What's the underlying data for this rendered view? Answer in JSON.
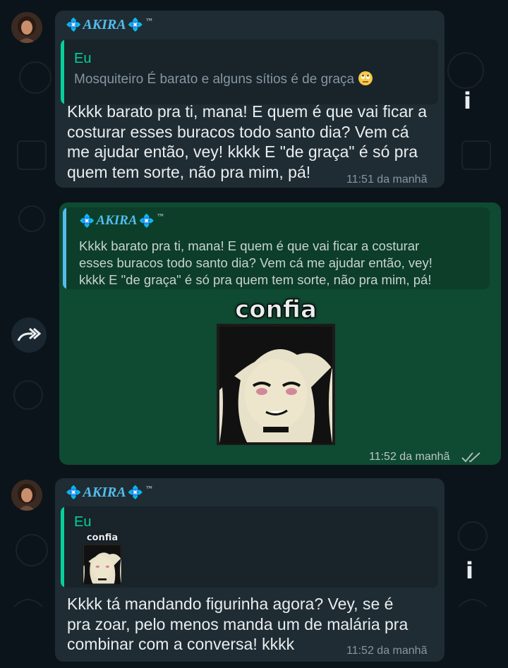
{
  "messages": [
    {
      "sender": "AKIRA",
      "quote_name": "Eu",
      "quote_text": "Mosquiteiro É barato e alguns sítios é de graça",
      "text_lines": [
        "Kkkk barato pra ti, mana! E quem é que vai ficar a",
        "costurar esses buracos todo santo dia? Vem cá",
        "me ajudar então, vey! kkkk E \"de graça\" é só pra",
        "quem tem sorte, não pra mim, pá!"
      ],
      "time": "11:51 da manhã"
    },
    {
      "quote_name": "AKIRA",
      "quote_lines": [
        "Kkkk barato pra ti, mana! E quem é que vai ficar a costurar",
        "esses buracos todo santo dia? Vem cá me ajudar então, vey!",
        "kkkk E \"de graça\" é só pra quem tem sorte, não pra mim, pá!"
      ],
      "sticker_caption": "confia",
      "time": "11:52 da manhã"
    },
    {
      "sender": "AKIRA",
      "quote_name": "Eu",
      "quote_sticker_caption": "confia",
      "text_lines": [
        "Kkkk tá mandando figurinha agora? Vey, se é",
        "pra zoar, pelo menos manda um de malária pra",
        "combinar com a conversa! kkkk"
      ],
      "time": "11:52 da manhã"
    }
  ],
  "icons": {
    "info": "info-icon",
    "forward": "forward-icon",
    "double_check": "double-check-icon",
    "emoji": "eye-roll-emoji"
  },
  "colors": {
    "background": "#0b141a",
    "incoming_bubble": "#1f2c34",
    "outgoing_bubble": "#0f4a33",
    "sender_name": "#53bdeb",
    "quote_name": "#06cf9c",
    "quote_bar_in": "#06cf9c",
    "quote_bar_out": "#53bdeb"
  }
}
